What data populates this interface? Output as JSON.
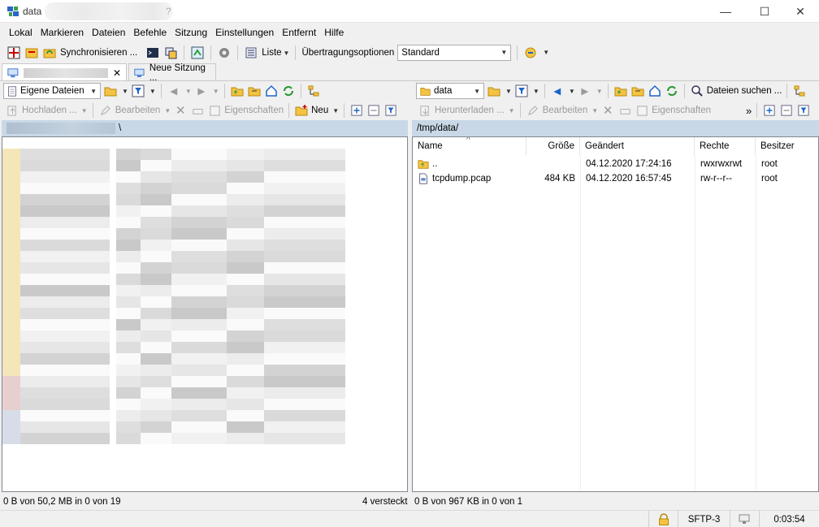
{
  "window": {
    "title": "data",
    "minimize_glyph": "—",
    "maximize_glyph": "☐",
    "close_glyph": "✕"
  },
  "menu": [
    "Lokal",
    "Markieren",
    "Dateien",
    "Befehle",
    "Sitzung",
    "Einstellungen",
    "Entfernt",
    "Hilfe"
  ],
  "toolbar": {
    "sync_label": "Synchronisieren ...",
    "view_label": "Liste",
    "transfer_label": "Übertragungsoptionen",
    "transfer_value": "Standard"
  },
  "tabs": {
    "session_close": "✕",
    "new_session_label": "Neue Sitzung ..."
  },
  "left_pane": {
    "location": "Eigene Dateien",
    "upload_label": "Hochladen ...",
    "edit_label": "Bearbeiten",
    "properties_label": "Eigenschaften",
    "new_label": "Neu",
    "path_suffix": "\\",
    "status": "0 B von 50,2 MB in 0 von 19",
    "hidden": "4 versteckt"
  },
  "right_pane": {
    "location": "data",
    "find_label": "Dateien suchen ...",
    "download_label": "Herunterladen ...",
    "edit_label": "Bearbeiten",
    "properties_label": "Eigenschaften",
    "more": "»",
    "path": "/tmp/data/",
    "sort_glyph": "^",
    "columns": {
      "name": "Name",
      "size": "Größe",
      "modified": "Geändert",
      "rights": "Rechte",
      "owner": "Besitzer"
    },
    "files": [
      {
        "name": "..",
        "size": "",
        "modified": "04.12.2020 17:24:16",
        "rights": "rwxrwxrwt",
        "owner": "root",
        "icon": "parent-folder-icon"
      },
      {
        "name": "tcpdump.pcap",
        "size": "484 KB",
        "modified": "04.12.2020 16:57:45",
        "rights": "rw-r--r--",
        "owner": "root",
        "icon": "file-icon"
      }
    ],
    "status": "0 B von 967 KB in 0 von 1"
  },
  "bottom": {
    "protocol": "SFTP-3",
    "elapsed": "0:03:54"
  },
  "colors": {
    "path_bar": "#c8d8e6",
    "folder": "#f5c342",
    "accent_blue": "#1c64c8",
    "refresh_green": "#2e9a3a"
  }
}
